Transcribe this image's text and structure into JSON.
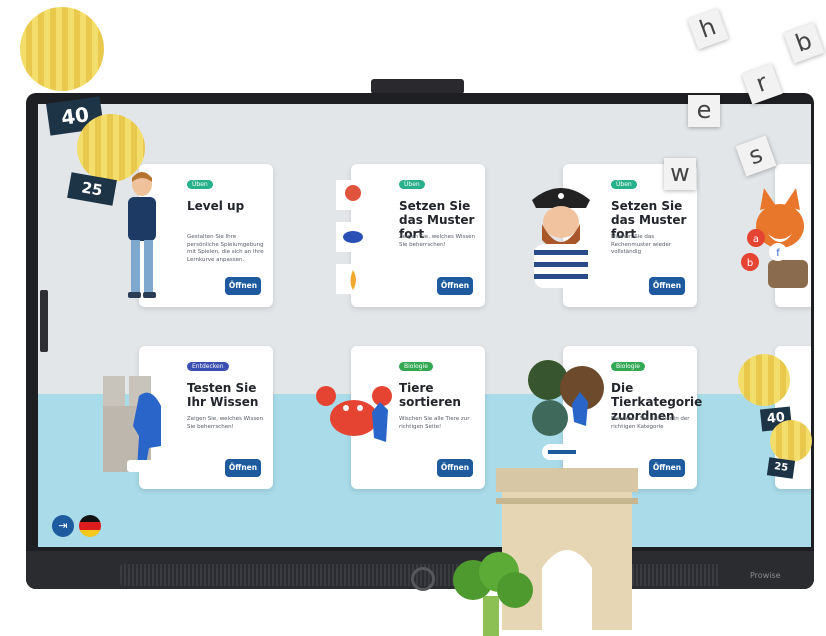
{
  "cards": [
    {
      "badge": "Üben",
      "badge_color": "#27b08a",
      "title": "Level up",
      "desc": "Gestalten Sie Ihre persönliche Spielumgebung mit Spielen, die sich an Ihre Lernkurve anpassen.",
      "button": "Öffnen"
    },
    {
      "badge": "Üben",
      "badge_color": "#27b08a",
      "title": "Setzen Sie das Muster fort",
      "desc": "Zeigen Sie, welches Wissen Sie beherrschen!",
      "button": "Öffnen"
    },
    {
      "badge": "Üben",
      "badge_color": "#27b08a",
      "title": "Setzen Sie das Muster fort",
      "desc": "Machen Sie das Rechenmuster wieder vollständig",
      "button": "Öffnen"
    },
    {
      "badge": "Entdecken",
      "badge_color": "#3a4fb0",
      "title": "Testen Sie Ihr Wissen",
      "desc": "Zeigen Sie, welches Wissen Sie beherrschen!",
      "button": "Öffnen"
    },
    {
      "badge": "Biologie",
      "badge_color": "#33a852",
      "title": "Tiere sortieren",
      "desc": "Wischen Sie alle Tiere zur richtigen Seite!",
      "button": "Öffnen"
    },
    {
      "badge": "Biologie",
      "badge_color": "#33a852",
      "title": "Die Tierkategorie zuordnen",
      "desc": "Platzieren Sie das Tier in der richtigen Kategorie",
      "button": "Öffnen"
    }
  ],
  "balloons": {
    "top_large": "40",
    "top_small": "25",
    "right_large": "40",
    "right_small": "25"
  },
  "letters": [
    "h",
    "b",
    "r",
    "e",
    "w",
    "s"
  ],
  "fox_letters": [
    "a",
    "b",
    "f"
  ],
  "brand": "Prowise",
  "icons": {
    "exit": "exit-icon",
    "flag": "germany-flag-icon"
  }
}
